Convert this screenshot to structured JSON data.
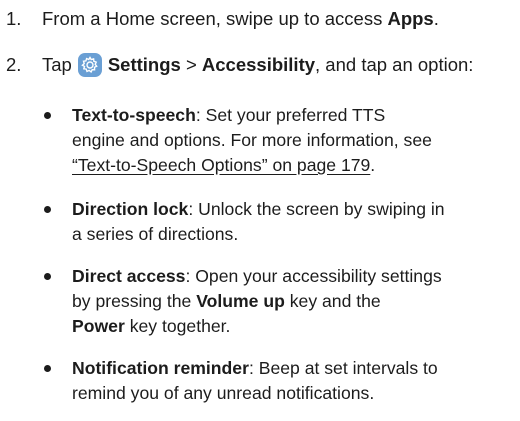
{
  "steps": [
    {
      "number": "1.",
      "text_before": "From a Home screen, swipe up to access ",
      "bold": "Apps",
      "text_after": "."
    },
    {
      "number": "2.",
      "tap": "Tap",
      "icon": "settings-gear-icon",
      "bold_settings": "Settings",
      "separator": " > ",
      "bold_accessibility": "Accessibility",
      "text_after": ", and tap an option:"
    }
  ],
  "bullets": [
    {
      "term": "Text-to-speech",
      "line1": ": Set your preferred TTS",
      "line2": "engine and options. For more information, see",
      "link": "“Text-to-Speech Options” on page 179",
      "after_link": "."
    },
    {
      "term": "Direction lock",
      "line1": ": Unlock the screen by swiping in",
      "line2": "a series of directions."
    },
    {
      "term": "Direct access",
      "line1": ": Open your accessibility settings",
      "line2a": "by pressing the ",
      "line2_bold": "Volume up",
      "line2b": " key and the",
      "line3_bold": "Power",
      "line3": " key together."
    },
    {
      "term": "Notification reminder",
      "line1": ": Beep at set intervals to",
      "line2": "remind you of any unread notifications."
    }
  ],
  "colors": {
    "text": "#1c1c1c",
    "settings_icon_bg": "#6a9fd4"
  }
}
